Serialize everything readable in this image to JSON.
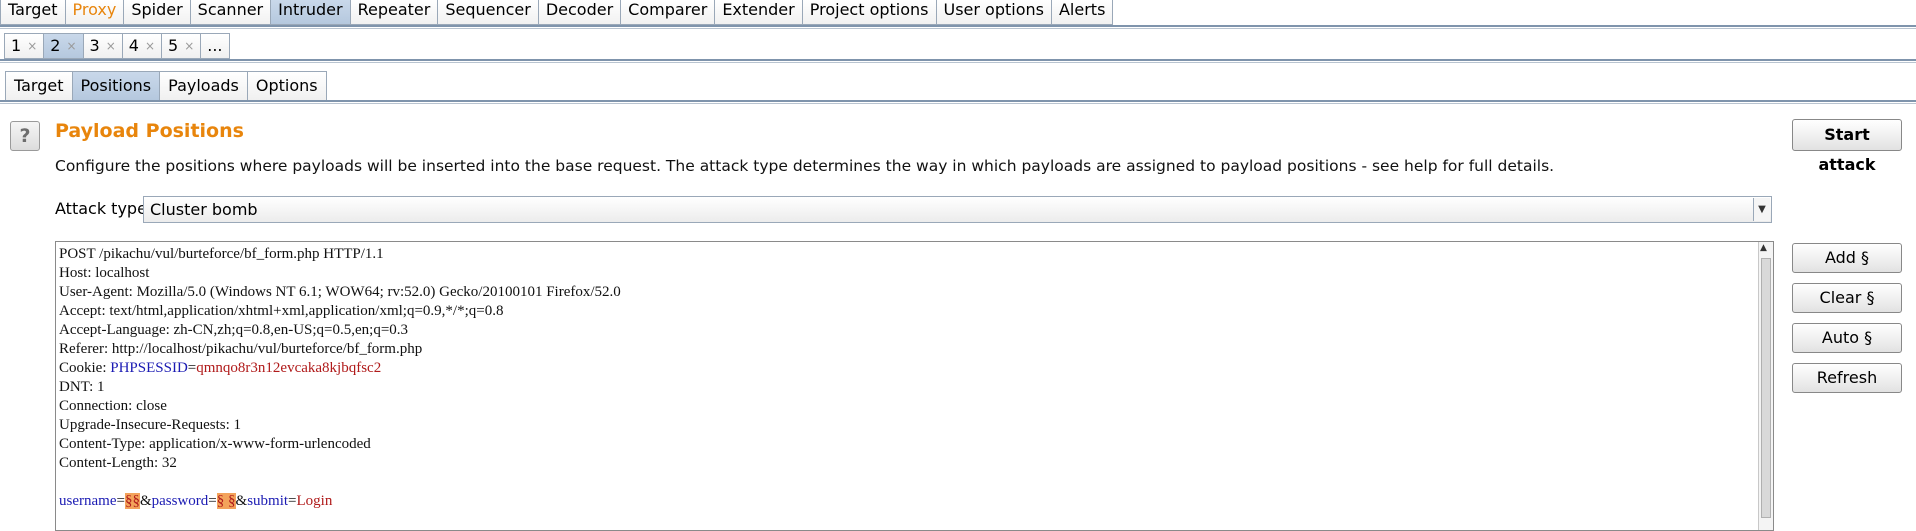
{
  "main_tabs": [
    "Target",
    "Proxy",
    "Spider",
    "Scanner",
    "Intruder",
    "Repeater",
    "Sequencer",
    "Decoder",
    "Comparer",
    "Extender",
    "Project options",
    "User options",
    "Alerts"
  ],
  "num_tabs": [
    {
      "label": "1",
      "close": "×"
    },
    {
      "label": "2",
      "close": "×"
    },
    {
      "label": "3",
      "close": "×"
    },
    {
      "label": "4",
      "close": "×"
    },
    {
      "label": "5",
      "close": "×"
    },
    {
      "label": "...",
      "close": ""
    }
  ],
  "sub_tabs": [
    "Target",
    "Positions",
    "Payloads",
    "Options"
  ],
  "panel": {
    "help": "?",
    "title": "Payload Positions",
    "description": "Configure the positions where payloads will be inserted into the base request. The attack type determines the way in which payloads are assigned to payload positions - see help for full details.",
    "attack_label": "Attack type:",
    "attack_value": "Cluster bomb",
    "start_attack": "Start attack"
  },
  "side_buttons": {
    "add": "Add §",
    "clear": "Clear §",
    "auto": "Auto §",
    "refresh": "Refresh"
  },
  "request": {
    "line1": "POST /pikachu/vul/burteforce/bf_form.php HTTP/1.1",
    "line2": "Host: localhost",
    "line3": "User-Agent: Mozilla/5.0 (Windows NT 6.1; WOW64; rv:52.0) Gecko/20100101 Firefox/52.0",
    "line4": "Accept: text/html,application/xhtml+xml,application/xml;q=0.9,*/*;q=0.8",
    "line5": "Accept-Language: zh-CN,zh;q=0.8,en-US;q=0.5,en;q=0.3",
    "line6": "Referer: http://localhost/pikachu/vul/burteforce/bf_form.php",
    "cookie_prefix": "Cookie: ",
    "cookie_key": "PHPSESSID",
    "cookie_eq": "=",
    "cookie_val": "qmnqo8r3n12evcaka8kjbqfsc2",
    "line8": "DNT: 1",
    "line9": "Connection: close",
    "line10": "Upgrade-Insecure-Requests: 1",
    "line11": "Content-Type: application/x-www-form-urlencoded",
    "line12": "Content-Length: 32",
    "body_user_key": "username",
    "body_eq1": "=",
    "body_user_marker": "§§",
    "body_amp1": "&",
    "body_pass_key": "password",
    "body_eq2": "=",
    "body_pass_marker": "§ §",
    "body_amp2": "&",
    "body_submit_key": "submit",
    "body_eq3": "=",
    "body_submit_val": "Login"
  }
}
